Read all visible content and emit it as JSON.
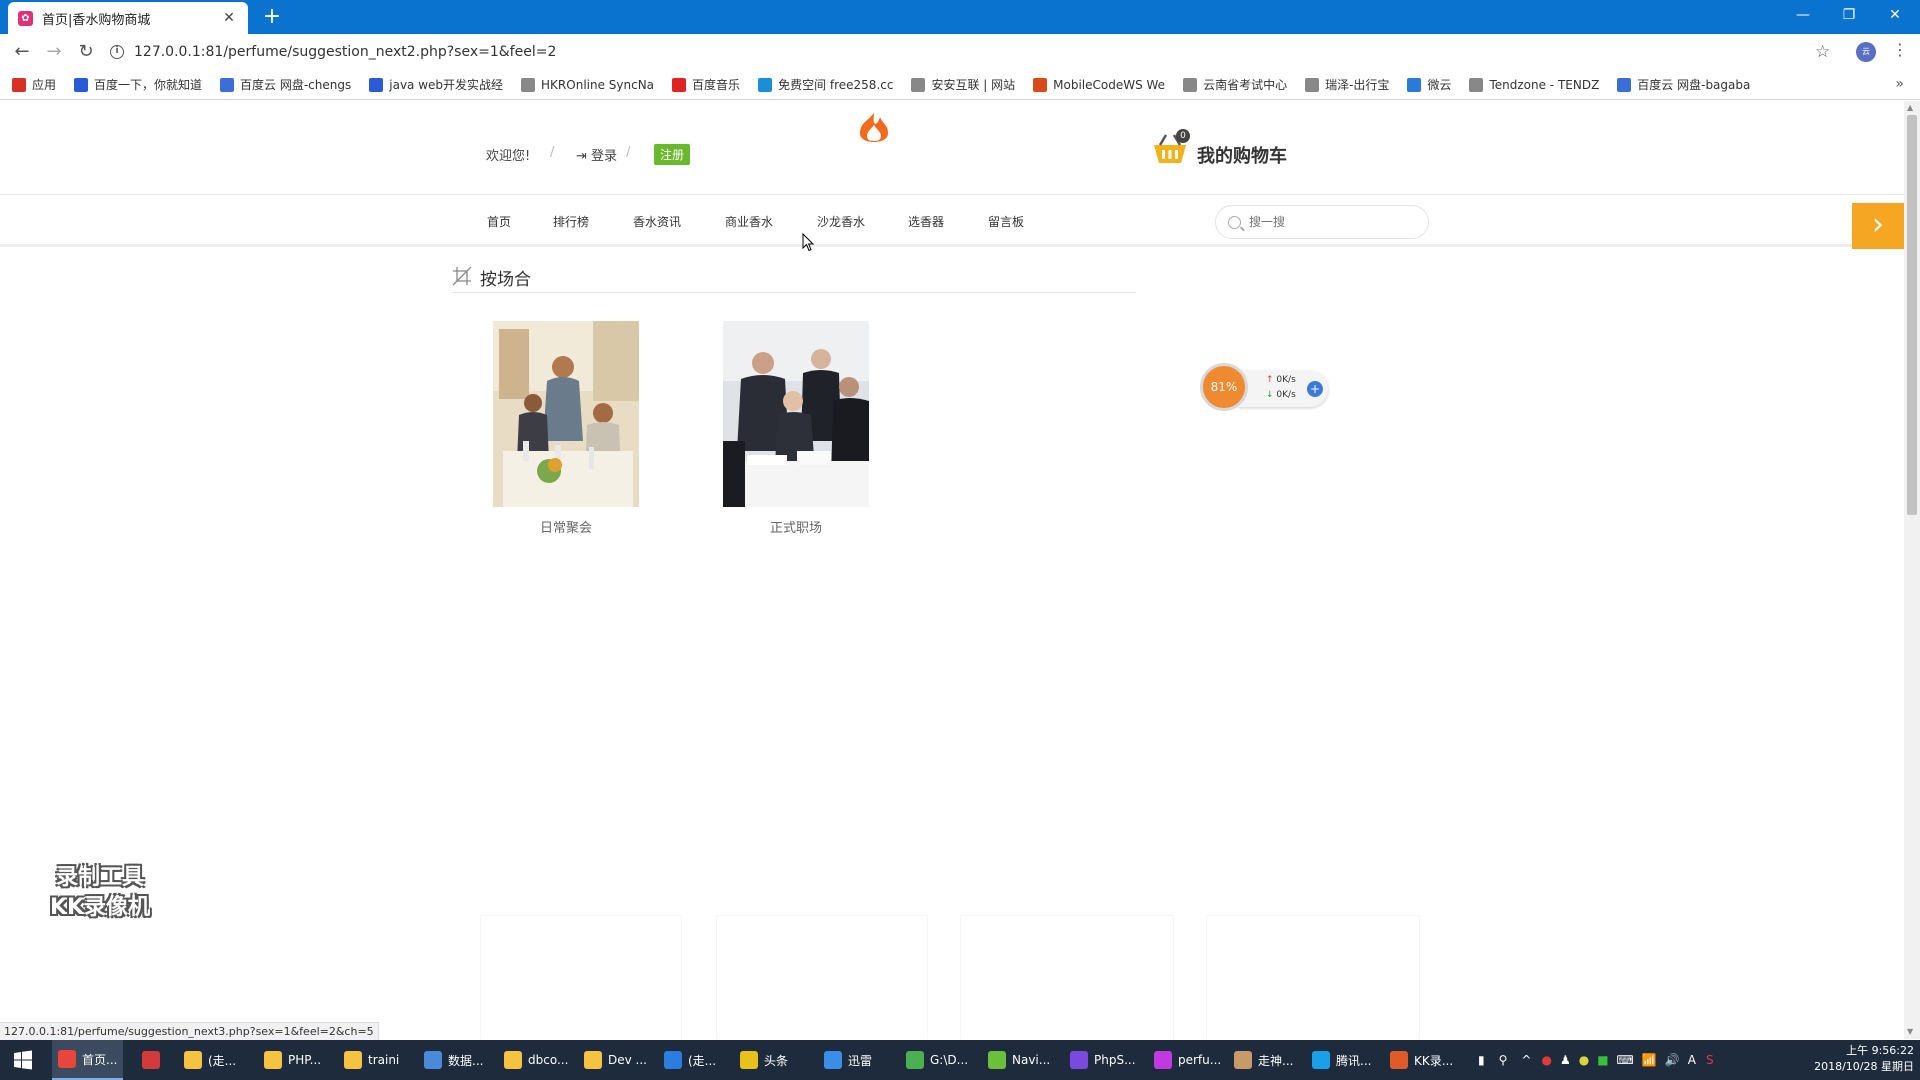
{
  "browser": {
    "tab_title": "首页|香水购物商城",
    "url": "127.0.0.1:81/perfume/suggestion_next2.php?sex=1&feel=2",
    "status_url": "127.0.0.1:81/perfume/suggestion_next3.php?sex=1&feel=2&ch=5"
  },
  "bookmarks": [
    {
      "label": "应用",
      "icon": "apps-icon",
      "color": "#d93025"
    },
    {
      "label": "百度一下，你就知道",
      "icon": "baidu-icon",
      "color": "#2a5bd7"
    },
    {
      "label": "百度云 网盘-chengs",
      "icon": "baiduyun-icon",
      "color": "#3b6fd8"
    },
    {
      "label": "java web开发实战经",
      "icon": "baidu-icon",
      "color": "#2a5bd7"
    },
    {
      "label": "HKROnline SyncNa",
      "icon": "page-icon",
      "color": "#888888"
    },
    {
      "label": "百度音乐",
      "icon": "music-icon",
      "color": "#e02424"
    },
    {
      "label": "免费空间 free258.cc",
      "icon": "globe-icon",
      "color": "#1a8fd8"
    },
    {
      "label": "安安互联 | 网站",
      "icon": "page-icon",
      "color": "#888888"
    },
    {
      "label": "MobileCodeWS We",
      "icon": "codews-icon",
      "color": "#d84a1a"
    },
    {
      "label": "云南省考试中心",
      "icon": "page-icon",
      "color": "#888888"
    },
    {
      "label": "瑞泽-出行宝",
      "icon": "page-icon",
      "color": "#888888"
    },
    {
      "label": "微云",
      "icon": "weiyun-icon",
      "color": "#2a7ad8"
    },
    {
      "label": "Tendzone - TENDZ",
      "icon": "page-icon",
      "color": "#888888"
    },
    {
      "label": "百度云 网盘-bagaba",
      "icon": "baiduyun-icon",
      "color": "#3b6fd8"
    }
  ],
  "site": {
    "welcome": "欢迎您!",
    "separator": "/",
    "login": "登录",
    "register": "注册",
    "cart_count": "0",
    "cart_label": "我的购物车",
    "nav": [
      "首页",
      "排行榜",
      "香水资讯",
      "商业香水",
      "沙龙香水",
      "选香器",
      "留言板"
    ],
    "search_placeholder": "搜一搜",
    "side_arrow": "›",
    "section_title": "按场合",
    "products": [
      {
        "caption": "日常聚会"
      },
      {
        "caption": "正式职场"
      }
    ]
  },
  "speed_widget": {
    "percent": "81%",
    "upload": "0K/s",
    "download": "0K/s"
  },
  "watermark": {
    "line1": "录制工具",
    "line2": "KK录像机"
  },
  "taskbar": {
    "items": [
      {
        "label": "首页...",
        "color": "#e8453c",
        "active": true
      },
      {
        "label": "",
        "color": "#d33a3a"
      },
      {
        "label": "(走...",
        "color": "#f5c242"
      },
      {
        "label": "PHP...",
        "color": "#f5c242"
      },
      {
        "label": "traini",
        "color": "#f5c242"
      },
      {
        "label": "数据...",
        "color": "#4a8ad8"
      },
      {
        "label": "dbco...",
        "color": "#f5c242"
      },
      {
        "label": "Dev ...",
        "color": "#f5c242"
      },
      {
        "label": "(走...",
        "color": "#2b7de0"
      },
      {
        "label": "头条",
        "color": "#e8c21a"
      },
      {
        "label": "迅雷",
        "color": "#3a8ee8"
      },
      {
        "label": "G:\\D...",
        "color": "#4caf50"
      },
      {
        "label": "Navi...",
        "color": "#6ac03a"
      },
      {
        "label": "PhpS...",
        "color": "#7a4ae0"
      },
      {
        "label": "perfu...",
        "color": "#c03ae0"
      },
      {
        "label": "走神...",
        "color": "#c89a6a"
      },
      {
        "label": "腾讯...",
        "color": "#1aa0e8"
      },
      {
        "label": "KK录...",
        "color": "#e05a2a"
      }
    ],
    "time": "上午 9:56:22",
    "date": "2018/10/28 星期日"
  }
}
